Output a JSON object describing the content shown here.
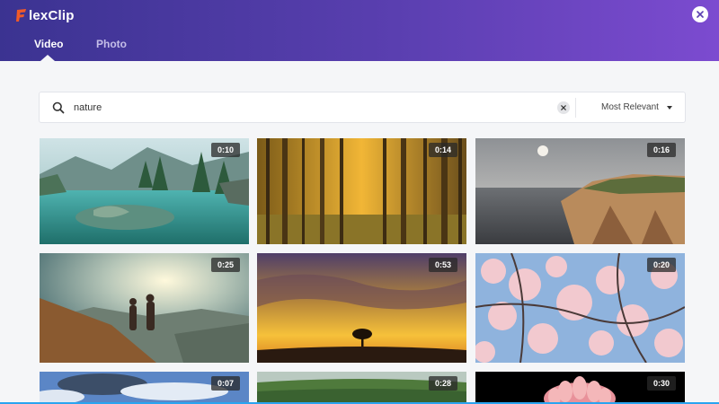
{
  "header": {
    "logo_text": "lexClip",
    "logo_letter": "F"
  },
  "tabs": [
    {
      "label": "Video",
      "active": true
    },
    {
      "label": "Photo",
      "active": false
    }
  ],
  "search": {
    "value": "nature",
    "placeholder": "",
    "sort_label": "Most Relevant"
  },
  "colors": {
    "header_start": "#3b3391",
    "header_end": "#7c4bd0",
    "logo_accent": "#f05a28"
  },
  "results": [
    {
      "duration": "0:10",
      "scene": "lake"
    },
    {
      "duration": "0:14",
      "scene": "forest"
    },
    {
      "duration": "0:16",
      "scene": "cliff"
    },
    {
      "duration": "0:25",
      "scene": "hikers"
    },
    {
      "duration": "0:53",
      "scene": "sunset"
    },
    {
      "duration": "0:20",
      "scene": "blossom"
    },
    {
      "duration": "0:07",
      "scene": "sky"
    },
    {
      "duration": "0:28",
      "scene": "field"
    },
    {
      "duration": "0:30",
      "scene": "flower"
    }
  ]
}
